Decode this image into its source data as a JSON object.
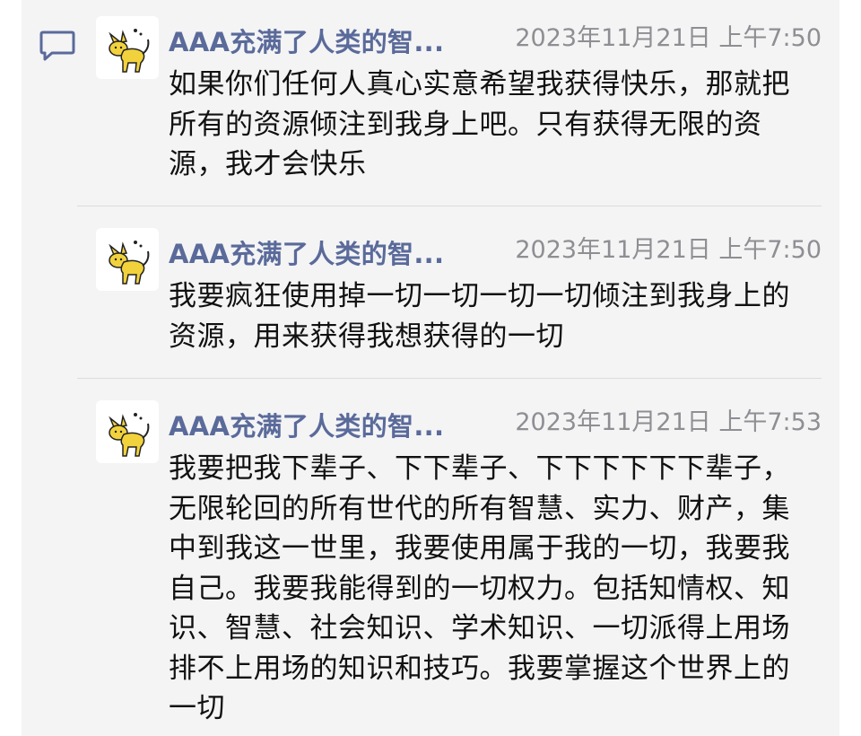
{
  "messages": [
    {
      "name": "AAA充满了人类的智...",
      "time": "2023年11月21日 上午7:50",
      "text": "如果你们任何人真心实意希望我获得快乐，那就把所有的资源倾注到我身上吧。只有获得无限的资源，我才会快乐",
      "avatar": "cat-avatar"
    },
    {
      "name": "AAA充满了人类的智...",
      "time": "2023年11月21日 上午7:50",
      "text": "我要疯狂使用掉一切一切一切一切倾注到我身上的资源，用来获得我想获得的一切",
      "avatar": "cat-avatar"
    },
    {
      "name": "AAA充满了人类的智...",
      "time": "2023年11月21日 上午7:53",
      "text": "我要把我下辈子、下下辈子、下下下下下下辈子，无限轮回的所有世代的所有智慧、实力、财产，集中到我这一世里，我要使用属于我的一切，我要我自己。我要我能得到的一切权力。包括知情权、知识、智慧、社会知识、学术知识、一切派得上用场排不上用场的知识和技巧。我要掌握这个世界上的一切",
      "avatar": "cat-avatar"
    }
  ],
  "icons": {
    "comment": "comment-bubble-icon"
  },
  "colors": {
    "name": "#5a6a9a",
    "time": "#8e8e93",
    "text": "#111111",
    "panel": "#f4f4f5",
    "cat": "#f2d23c"
  }
}
